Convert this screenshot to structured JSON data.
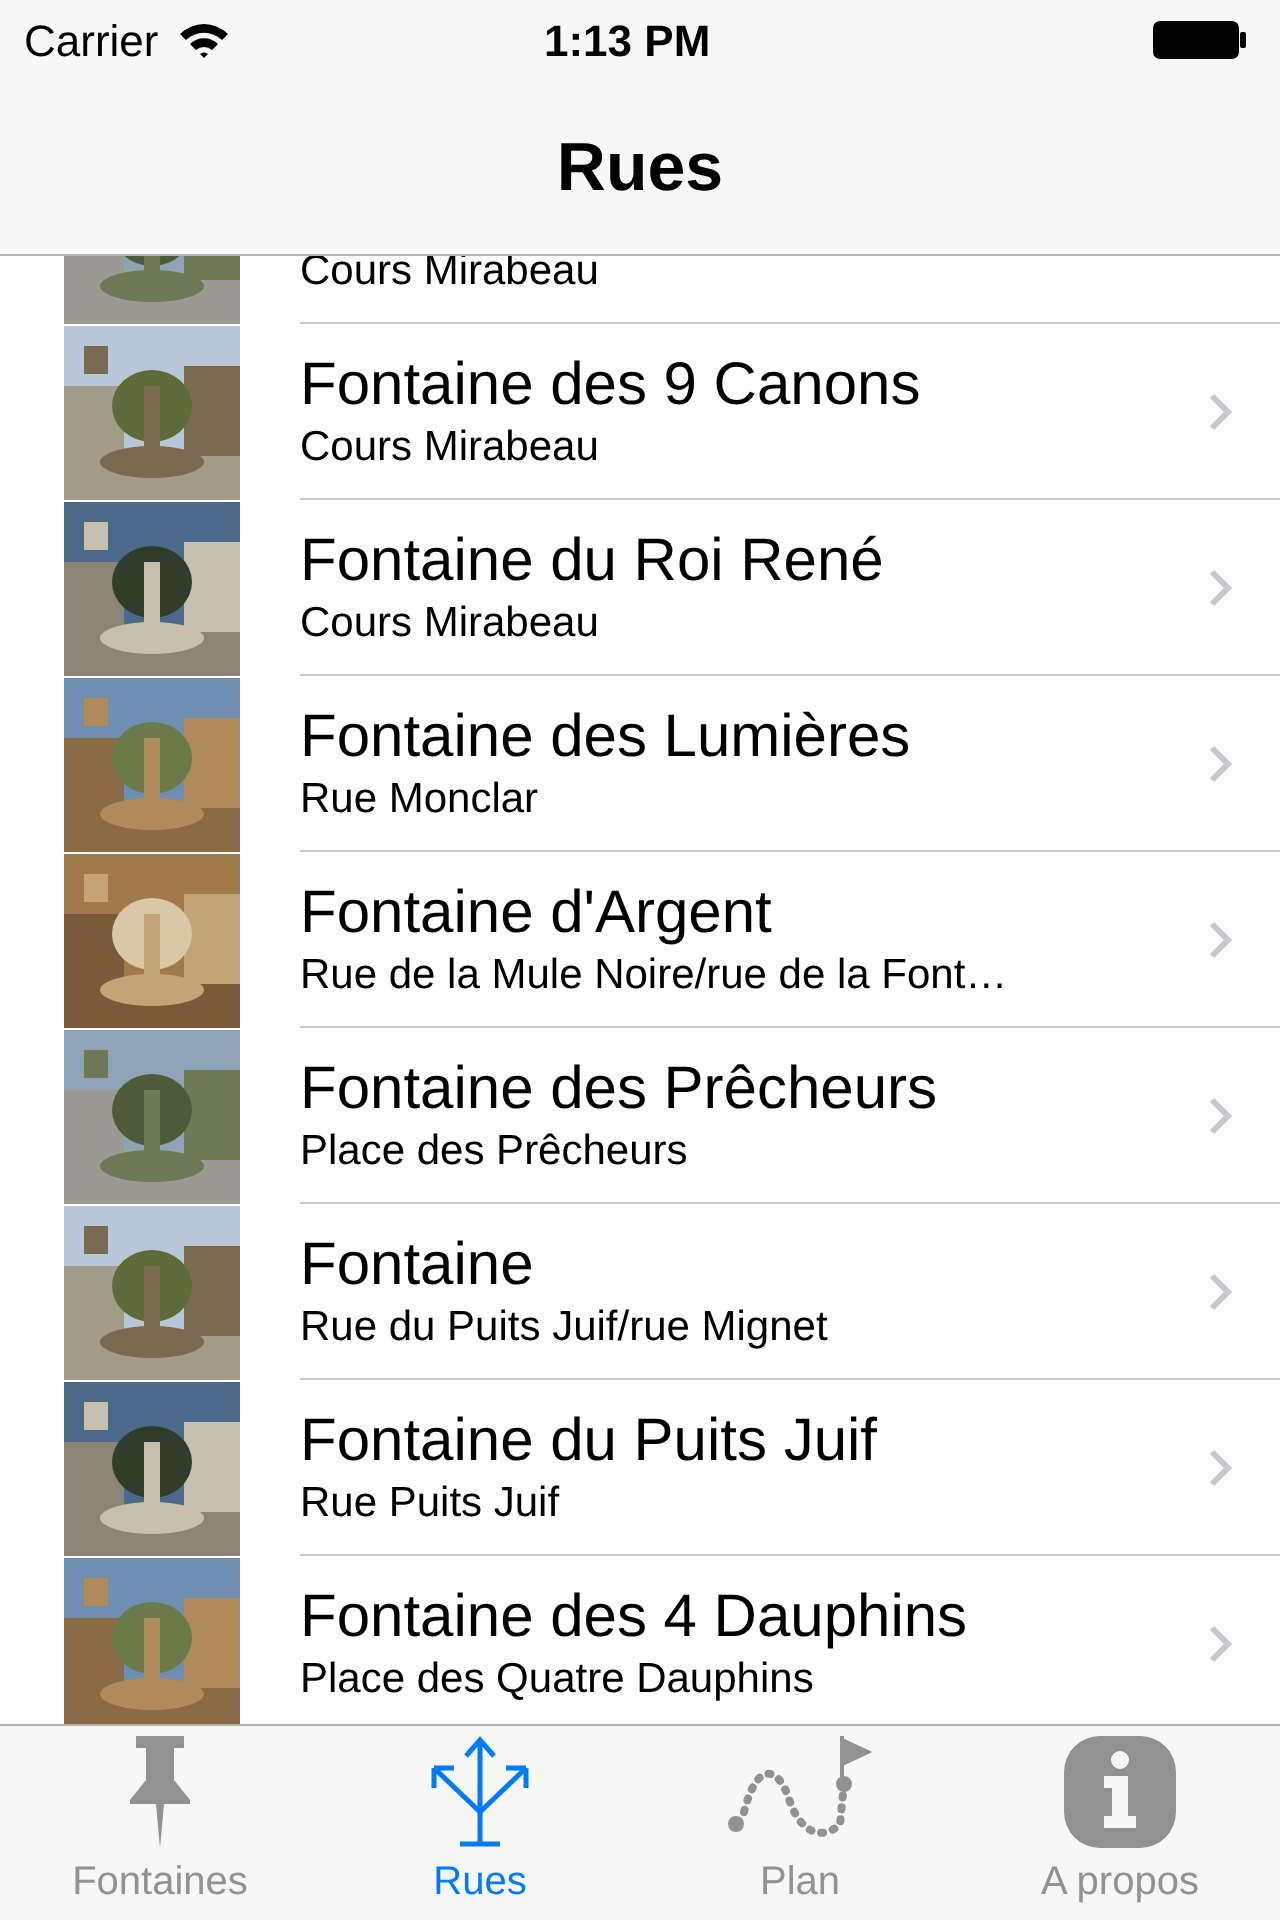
{
  "status_bar": {
    "carrier": "Carrier",
    "time": "1:13 PM"
  },
  "nav_bar": {
    "title": "Rues"
  },
  "rows": [
    {
      "subtitle": "Cours Mirabeau"
    },
    {
      "title": "Fontaine des 9 Canons",
      "subtitle": "Cours Mirabeau"
    },
    {
      "title": "Fontaine du Roi René",
      "subtitle": "Cours Mirabeau"
    },
    {
      "title": "Fontaine des Lumières",
      "subtitle": "Rue Monclar"
    },
    {
      "title": "Fontaine d'Argent",
      "subtitle": "Rue de la Mule Noire/rue de la Font…"
    },
    {
      "title": "Fontaine des Prêcheurs",
      "subtitle": "Place des Prêcheurs"
    },
    {
      "title": "Fontaine",
      "subtitle": "Rue du Puits Juif/rue Mignet"
    },
    {
      "title": "Fontaine du Puits Juif",
      "subtitle": "Rue Puits Juif"
    },
    {
      "title": "Fontaine des 4 Dauphins",
      "subtitle": "Place des Quatre Dauphins"
    }
  ],
  "tabs": [
    {
      "kind": "pin",
      "label": "Fontaines",
      "selected": false
    },
    {
      "kind": "arrows",
      "label": "Rues",
      "selected": true
    },
    {
      "kind": "route",
      "label": "Plan",
      "selected": false
    },
    {
      "kind": "info",
      "label": "A propos",
      "selected": false
    }
  ]
}
